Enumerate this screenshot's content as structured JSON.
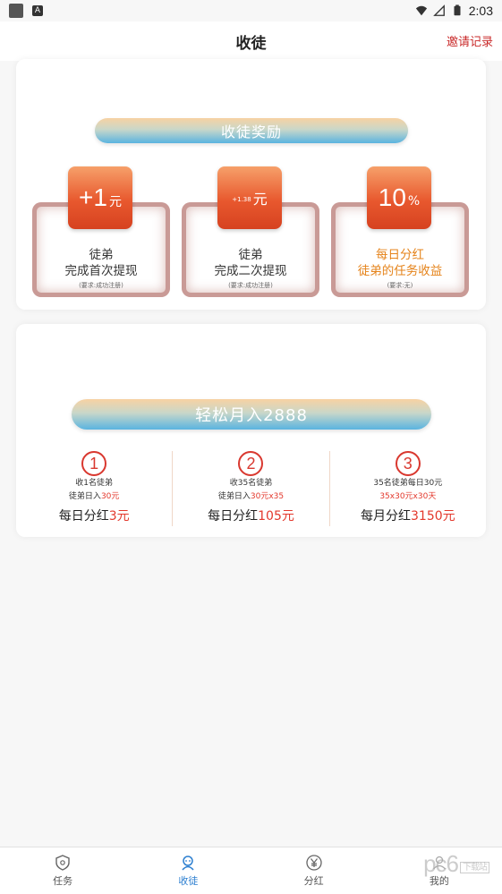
{
  "status_bar": {
    "time": "2:03",
    "app_badge": "A"
  },
  "header": {
    "title": "收徒",
    "invite_records": "邀请记录"
  },
  "reward_section": {
    "title": "收徒奖励",
    "items": [
      {
        "badge_value": "+1",
        "badge_unit": "元",
        "line1": "徒弟",
        "line2": "完成首次提现",
        "note": "(要求:成功注册)"
      },
      {
        "badge_value": "+1.38",
        "badge_unit": "元",
        "line1": "徒弟",
        "line2": "完成二次提现",
        "note": "(要求:成功注册)"
      },
      {
        "badge_value": "10",
        "badge_unit": "%",
        "line1": "每日分红",
        "line2": "徒弟的任务收益",
        "note": "(要求:无)"
      }
    ]
  },
  "income_section": {
    "title": "轻松月入2888",
    "steps": [
      {
        "num": "1",
        "line1": "收1名徒弟",
        "line2_a": "徒弟日入",
        "line2_b": "30元",
        "main_a": "每日分红",
        "main_b": "3元"
      },
      {
        "num": "2",
        "line1": "收35名徒弟",
        "line2_a": "徒弟日入",
        "line2_b": "30元x35",
        "main_a": "每日分红",
        "main_b": "105元"
      },
      {
        "num": "3",
        "line1": "35名徒弟每日30元",
        "line2_a": "",
        "line2_b": "35x30元x30天",
        "main_a": "每月分红",
        "main_b": "3150元"
      }
    ]
  },
  "tabs": [
    {
      "label": "任务",
      "icon": "shield-icon"
    },
    {
      "label": "收徒",
      "icon": "apprentice-icon"
    },
    {
      "label": "分红",
      "icon": "yen-icon"
    },
    {
      "label": "我的",
      "icon": "profile-icon"
    }
  ],
  "watermark": {
    "text": "pc6",
    "sub": "下载站"
  },
  "colors": {
    "accent_red": "#e3382c",
    "tab_active": "#2d7fd0",
    "badge_orange": "#e8582e"
  }
}
